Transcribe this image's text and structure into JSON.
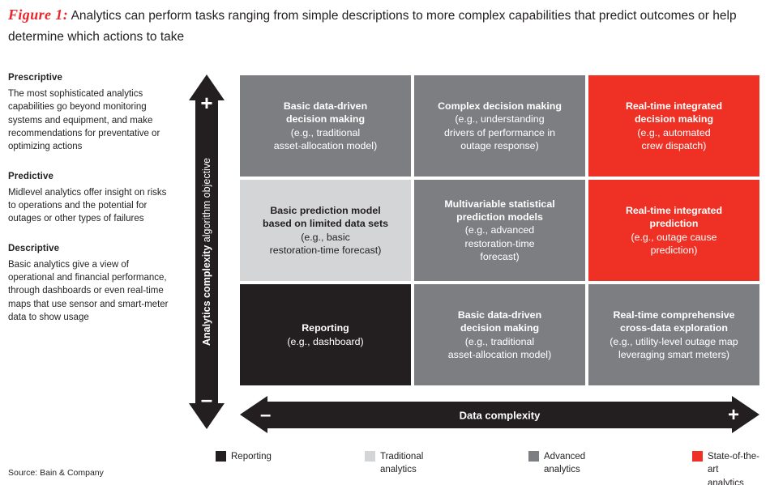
{
  "figure": {
    "label": "Figure 1:",
    "title_line1": "Analytics can perform tasks ranging from simple descriptions to more complex capabilities",
    "title_line2": "that predict outcomes or help determine which actions to take"
  },
  "sidebar": {
    "groups": [
      {
        "heading": "Prescriptive",
        "body": "The most sophisticated analytics capabilities go beyond monitoring systems and equipment, and make recommendations for preventative or optimizing actions"
      },
      {
        "heading": "Predictive",
        "body": "Midlevel analytics offer insight on risks to operations and the potential for outages or other types of failures"
      },
      {
        "heading": "Descriptive",
        "body": "Basic analytics give a view of operational and financial performance, through dashboards or even real-time maps that use sensor and smart-meter data to show usage"
      }
    ]
  },
  "source": "Source: Bain & Company",
  "y_axis": {
    "label_bold": "Analytics complexity",
    "label_regular": " algorithm objective",
    "plus": "+",
    "minus": "–"
  },
  "x_axis": {
    "label": "Data complexity",
    "plus": "+",
    "minus": "–"
  },
  "matrix": {
    "cells": [
      {
        "row": 0,
        "col": 0,
        "category": "advanced",
        "headline": "Basic data-driven\ndecision making",
        "example": "(e.g., traditional\nasset-allocation model)"
      },
      {
        "row": 0,
        "col": 1,
        "category": "advanced",
        "headline": "Complex decision making",
        "example": "(e.g., understanding\ndrivers of performance in\noutage response)"
      },
      {
        "row": 0,
        "col": 2,
        "category": "state-of-the-art",
        "headline": "Real-time integrated\ndecision making",
        "example": "(e.g., automated\ncrew dispatch)"
      },
      {
        "row": 1,
        "col": 0,
        "category": "traditional",
        "headline": "Basic prediction model\nbased on limited data sets",
        "example": "(e.g., basic\nrestoration-time forecast)"
      },
      {
        "row": 1,
        "col": 1,
        "category": "advanced",
        "headline": "Multivariable statistical\nprediction models",
        "example": "(e.g., advanced\nrestoration-time\nforecast)"
      },
      {
        "row": 1,
        "col": 2,
        "category": "state-of-the-art",
        "headline": "Real-time integrated\nprediction",
        "example": "(e.g., outage cause\nprediction)"
      },
      {
        "row": 2,
        "col": 0,
        "category": "reporting",
        "headline": "Reporting",
        "example": "(e.g., dashboard)"
      },
      {
        "row": 2,
        "col": 1,
        "category": "advanced",
        "headline": "Basic data-driven\ndecision making",
        "example": "(e.g., traditional\nasset-allocation model)"
      },
      {
        "row": 2,
        "col": 2,
        "category": "advanced",
        "headline": "Real-time comprehensive\ncross-data exploration",
        "example": "(e.g., utility-level outage map\nleveraging smart meters)"
      }
    ]
  },
  "legend": {
    "items": [
      {
        "label": "Reporting",
        "color": "#231f20"
      },
      {
        "label": "Traditional\nanalytics",
        "color": "#d4d5d7"
      },
      {
        "label": "Advanced\nanalytics",
        "color": "#7c7e82"
      },
      {
        "label": "State-of-the-art\nanalytics",
        "color": "#ee3124"
      }
    ]
  },
  "colors": {
    "reporting": "#231f20",
    "traditional": "#d4d5d7",
    "advanced": "#7c7e82",
    "state_of_the_art": "#ee3124",
    "accent_red": "#e8262a"
  }
}
